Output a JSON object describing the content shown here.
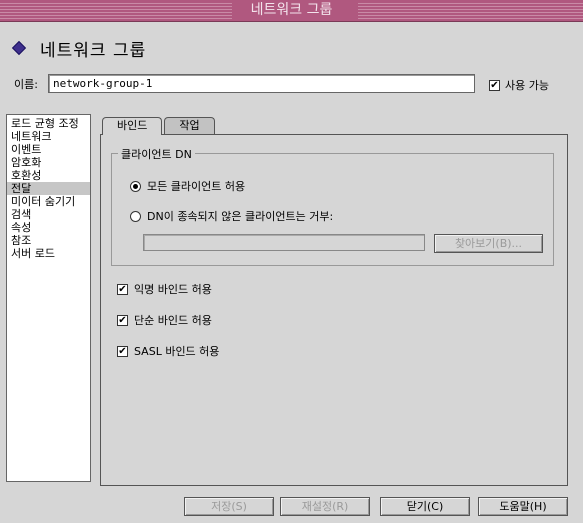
{
  "window": {
    "title": "네트워크 그룹"
  },
  "header": {
    "title": "네트워크 그룹"
  },
  "name": {
    "label": "이름:",
    "value": "network-group-1"
  },
  "enabled": {
    "label": "사용 가능",
    "checked": true
  },
  "sidebar": {
    "items": [
      {
        "label": "로드 균형 조정"
      },
      {
        "label": "네트워크"
      },
      {
        "label": "이벤트"
      },
      {
        "label": "암호화"
      },
      {
        "label": "호환성"
      },
      {
        "label": "전달"
      },
      {
        "label": "미이터 숨기기"
      },
      {
        "label": "검색"
      },
      {
        "label": "속성"
      },
      {
        "label": "참조"
      },
      {
        "label": "서버 로드"
      }
    ],
    "selected": "전달"
  },
  "tabs": [
    {
      "label": "바인드"
    },
    {
      "label": "작업"
    }
  ],
  "client_dn": {
    "group_label": "클라이언트 DN",
    "allow_all": "모든 클라이언트 허용",
    "deny_unbound": "DN이 종속되지 않은 클라이언트는 거부:",
    "browse": "찾아보기(B)..."
  },
  "options": {
    "anonymous": "익명 바인드 허용",
    "simple": "단순 바인드 허용",
    "sasl": "SASL 바인드 허용"
  },
  "footer": {
    "save": "저장(S)",
    "reset": "재설정(R)",
    "close": "닫기(C)",
    "help": "도움말(H)"
  }
}
